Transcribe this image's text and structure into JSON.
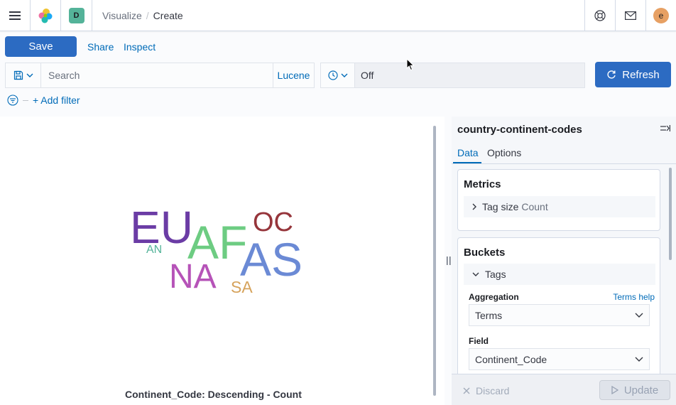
{
  "header": {
    "space_initial": "D",
    "breadcrumbs": {
      "parent": "Visualize",
      "separator": "/",
      "current": "Create"
    },
    "user_initial": "e",
    "icons": [
      "menu-icon",
      "elastic-logo",
      "help-icon",
      "mail-icon"
    ]
  },
  "top_nav": {
    "save_label": "Save",
    "share_label": "Share",
    "inspect_label": "Inspect"
  },
  "query_bar": {
    "search_placeholder": "Search",
    "language_label": "Lucene"
  },
  "time_bar": {
    "refresh_value": "Off",
    "refresh_label": "Refresh"
  },
  "filters": {
    "add_filter_label": "+ Add filter"
  },
  "visualization": {
    "words": [
      {
        "text": "EU",
        "color": "#6b3ca5"
      },
      {
        "text": "AF",
        "color": "#6dcc82"
      },
      {
        "text": "OC",
        "color": "#96353b"
      },
      {
        "text": "AS",
        "color": "#6b8ad5"
      },
      {
        "text": "AN",
        "color": "#54b399"
      },
      {
        "text": "NA",
        "color": "#b653b8"
      },
      {
        "text": "SA",
        "color": "#d6a35c"
      }
    ],
    "legend_title": "Continent_Code: Descending - Count"
  },
  "sidebar": {
    "title": "country-continent-codes",
    "tabs": [
      {
        "label": "Data"
      },
      {
        "label": "Options"
      }
    ],
    "metrics": {
      "title": "Metrics",
      "agg_label": "Tag size",
      "agg_sub": "Count"
    },
    "buckets": {
      "title": "Buckets",
      "agg_label": "Tags",
      "aggregation_label": "Aggregation",
      "help_link": "Terms help",
      "aggregation_value": "Terms",
      "field_label": "Field",
      "field_value": "Continent_Code"
    },
    "footer": {
      "discard_label": "Discard",
      "update_label": "Update"
    }
  },
  "colors": {
    "primary": "#2c6bc2",
    "link": "#006bb8",
    "space_badge": "#54b399",
    "user_avatar": "#e7a063"
  }
}
